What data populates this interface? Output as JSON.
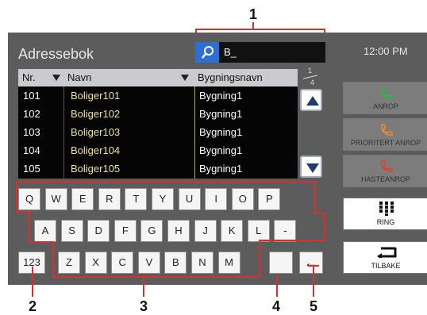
{
  "callouts": [
    "1",
    "2",
    "3",
    "4",
    "5"
  ],
  "screen": {
    "title": "Adressebok",
    "search": {
      "text": "B_"
    },
    "clock": "12:00 PM",
    "table": {
      "headers": [
        "Nr.",
        "Navn",
        "Bygningsnavn"
      ],
      "rows": [
        {
          "nr": "101",
          "name": "Boliger101",
          "building": "Bygning1"
        },
        {
          "nr": "102",
          "name": "Boliger102",
          "building": "Bygning1"
        },
        {
          "nr": "103",
          "name": "Boliger103",
          "building": "Bygning1"
        },
        {
          "nr": "104",
          "name": "Boliger104",
          "building": "Bygning1"
        },
        {
          "nr": "105",
          "name": "Boliger105",
          "building": "Bygning1"
        }
      ]
    },
    "page": {
      "current": "1",
      "total": "4"
    },
    "keyboard": {
      "row1": [
        "Q",
        "W",
        "E",
        "R",
        "T",
        "Y",
        "U",
        "I",
        "O",
        "P"
      ],
      "row2": [
        "A",
        "S",
        "D",
        "F",
        "G",
        "H",
        "J",
        "K",
        "L",
        "-"
      ],
      "row3": [
        "Z",
        "X",
        "C",
        "V",
        "B",
        "N",
        "M"
      ],
      "mode_key": "123",
      "space_key": "",
      "back_key": "←"
    },
    "side_buttons": [
      {
        "label": "ANROP",
        "icon": "phone-icon",
        "icon_color": "#2fb34a",
        "active": false
      },
      {
        "label": "PRIORITERT ANROP",
        "icon": "phone-icon",
        "icon_color": "#e8892b",
        "active": false
      },
      {
        "label": "HASTEANROP",
        "icon": "phone-icon",
        "icon_color": "#d9452b",
        "active": false
      },
      {
        "label": "RING",
        "icon": "keypad-icon",
        "icon_color": "#111111",
        "active": true
      },
      {
        "label": "TILBAKE",
        "icon": "return-icon",
        "icon_color": "#111111",
        "active": true
      }
    ]
  }
}
